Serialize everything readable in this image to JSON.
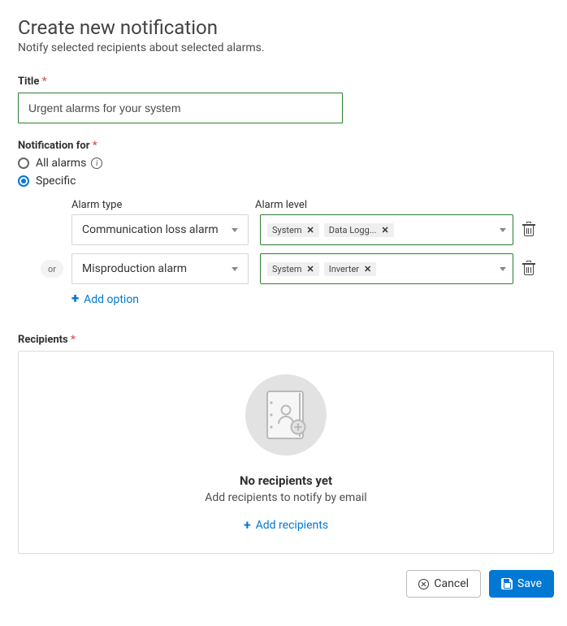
{
  "page": {
    "title": "Create new notification",
    "subtitle": "Notify selected recipients about selected alarms."
  },
  "title_field": {
    "label": "Title",
    "value": "Urgent alarms for your system"
  },
  "notification_for": {
    "label": "Notification for",
    "options": {
      "all_alarms": "All alarms",
      "specific": "Specific"
    },
    "selected": "specific"
  },
  "alarm_columns": {
    "type": "Alarm type",
    "level": "Alarm level"
  },
  "alarm_rows": [
    {
      "type": "Communication loss alarm",
      "levels": [
        "System",
        "Data Logg..."
      ]
    },
    {
      "type": "Misproduction alarm",
      "levels": [
        "System",
        "Inverter"
      ]
    }
  ],
  "row_separator": "or",
  "add_option_label": "Add option",
  "recipients": {
    "label": "Recipients",
    "empty_title": "No recipients yet",
    "empty_subtitle": "Add recipients to notify by email",
    "add_button": "Add recipients"
  },
  "footer": {
    "cancel": "Cancel",
    "save": "Save"
  }
}
